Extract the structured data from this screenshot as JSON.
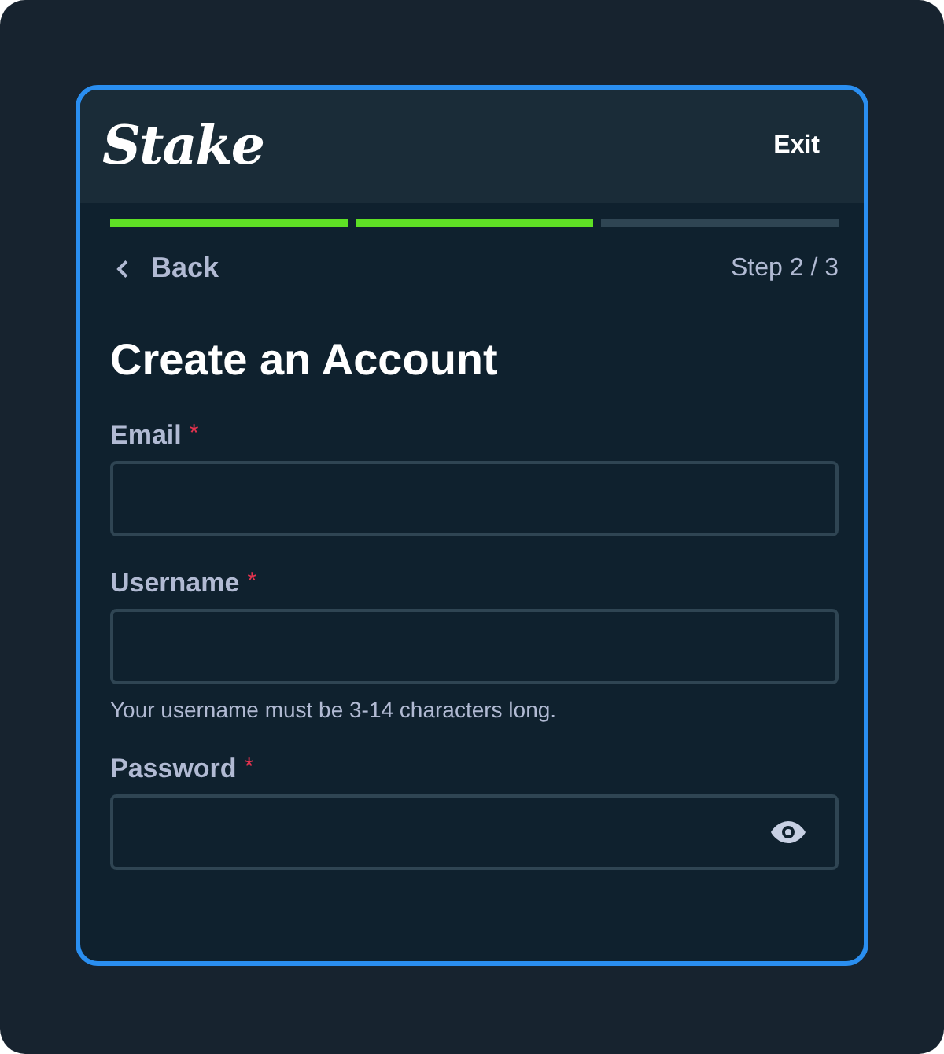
{
  "header": {
    "logo": "Stake",
    "exit": "Exit"
  },
  "progress": [
    {
      "done": true
    },
    {
      "done": true
    },
    {
      "done": false
    }
  ],
  "nav": {
    "back": "Back",
    "step": "Step 2 / 3"
  },
  "title": "Create an Account",
  "fields": [
    {
      "kind": "text",
      "label": "Email",
      "required_mark": "*"
    },
    {
      "kind": "text",
      "label": "Username",
      "required_mark": "*",
      "hint": "Your username must be 3-14 characters long."
    },
    {
      "kind": "password",
      "label": "Password",
      "required_mark": "*"
    }
  ]
}
